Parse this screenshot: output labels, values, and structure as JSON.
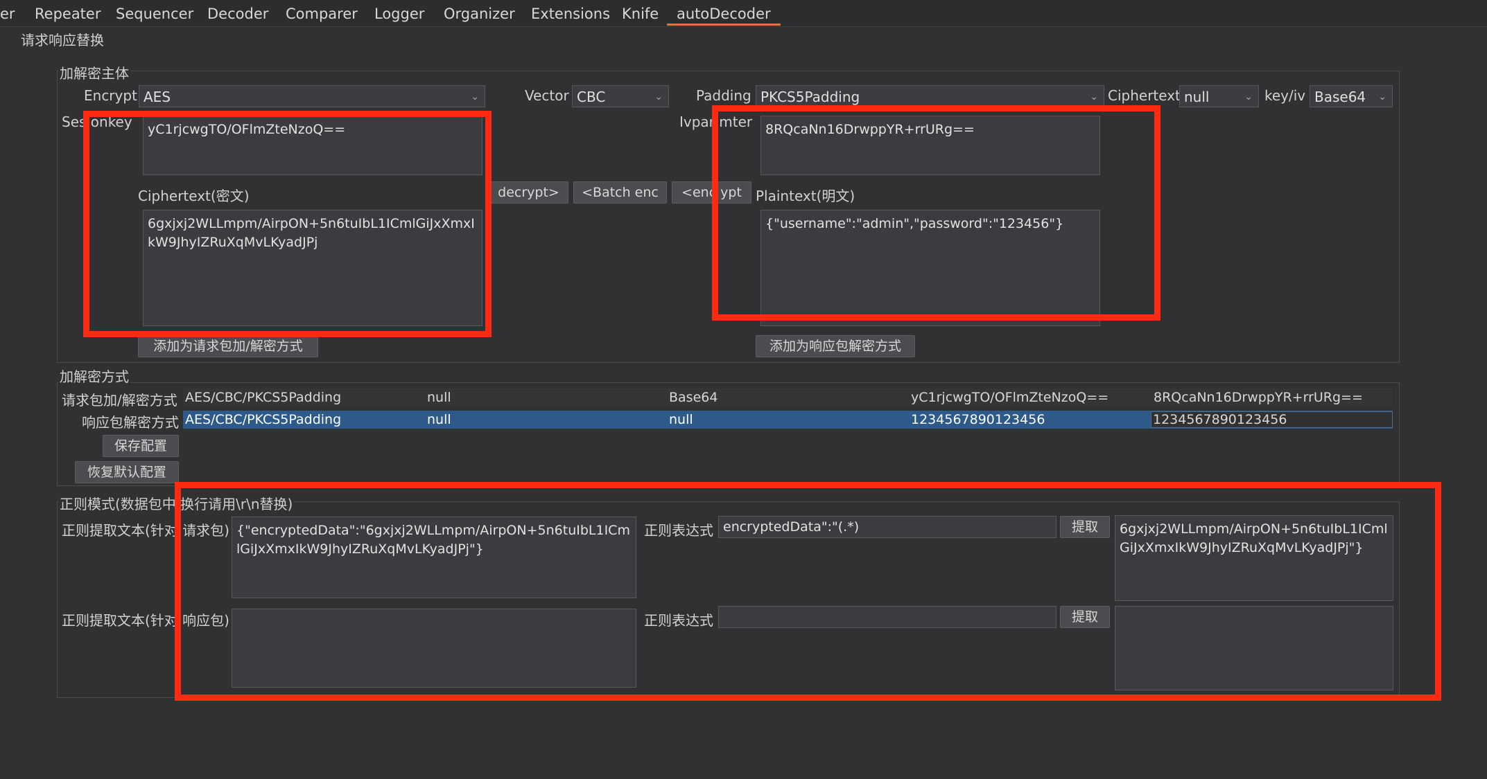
{
  "tabs": [
    "er",
    "Repeater",
    "Sequencer",
    "Decoder",
    "Comparer",
    "Logger",
    "Organizer",
    "Extensions",
    "Knife",
    "autoDecoder"
  ],
  "subtab": "请求响应替换",
  "main_group": {
    "title": "加解密主体",
    "encrypt_label": "Encrypt",
    "encrypt_value": "AES",
    "vector_label": "Vector",
    "vector_value": "CBC",
    "padding_label": "Padding",
    "padding_value": "PKCS5Padding",
    "ciphertext_label": "Ciphertext",
    "ciphertext_value": "null",
    "keyiv_label": "key/iv",
    "keyiv_value": "Base64",
    "sessionkey_label": "Ses onkey",
    "sessionkey_value": "yC1rjcwgTO/OFlmZteNzoQ==",
    "ivparam_label": "Ivpar mter",
    "ivparam_value": "8RQcaNn16DrwppYR+rrURg==",
    "ciphertext_area_label": "Ciphertext(密文)",
    "ciphertext_area_value": "6gxjxj2WLLmpm/AirpON+5n6tuIbL1ICmlGiJxXmxIkW9JhyIZRuXqMvLKyadJPj",
    "plaintext_area_label": "Plaintext(明文)",
    "plaintext_area_value": "{\"username\":\"admin\",\"password\":\"123456\"}",
    "decrypt_btn": "decrypt>",
    "batch_btn": "<Batch enc",
    "encrypt_btn": "<enc ypt",
    "add_request_btn": "添加为请求包加/解密方式",
    "add_response_btn": "添加为响应包解密方式"
  },
  "mode_group": {
    "title": "加解密方式",
    "rows": [
      {
        "label": "请求包加/解密方式",
        "mode": "AES/CBC/PKCS5Padding",
        "c2": "null",
        "c3": "Base64",
        "key": "yC1rjcwgTO/OFlmZteNzoQ==",
        "iv": "8RQcaNn16DrwppYR+rrURg=="
      },
      {
        "label": "响应包解密方式",
        "mode": "AES/CBC/PKCS5Padding",
        "c2": "null",
        "c3": "null",
        "key": "1234567890123456",
        "iv": "1234567890123456"
      }
    ],
    "save_btn": "保存配置",
    "restore_btn": "恢复默认配置"
  },
  "regex_group": {
    "title": "正则模式(数据包中 换行请用\\r\\n替换)",
    "req_label": "正则提取文本(针对 请求包)",
    "req_text": "{\"encryptedData\":\"6gxjxj2WLLmpm/AirpON+5n6tuIbL1ICmlGiJxXmxIkW9JhyIZRuXqMvLKyadJPj\"}",
    "req_expr_label": "正则表达式",
    "req_expr_value": "encryptedData\":\"(.*)",
    "req_extract_btn": "提取",
    "req_result": "6gxjxj2WLLmpm/AirpON+5n6tuIbL1ICmlGiJxXmxIkW9JhyIZRuXqMvLKyadJPj\"}",
    "resp_label": "正则提取文本(针对 响应包)",
    "resp_text": "",
    "resp_expr_label": "正则表达式",
    "resp_expr_value": "",
    "resp_extract_btn": "提取",
    "resp_result": ""
  },
  "colors": {
    "background": "#2f3133",
    "highlight_box": "#ff2a12",
    "selected_row": "#2e5a8a",
    "active_tab_underline": "#e0763a"
  }
}
